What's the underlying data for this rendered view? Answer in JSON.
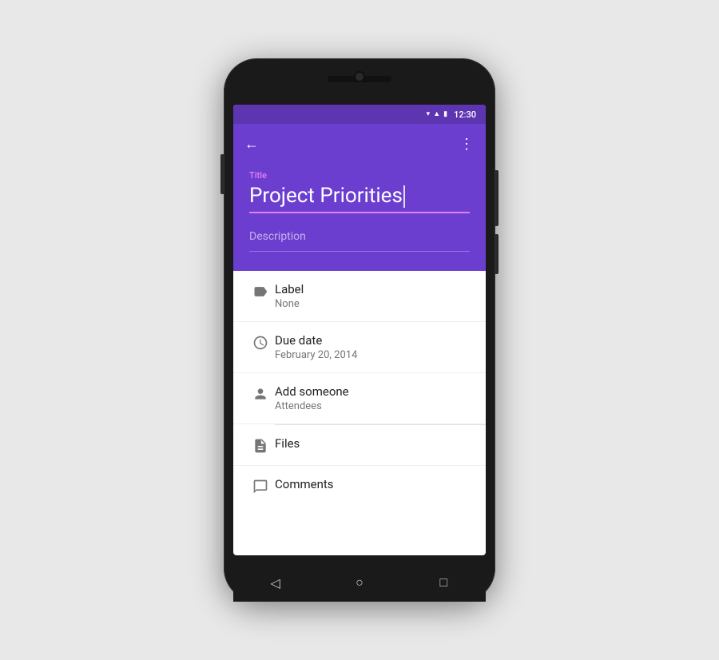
{
  "status_bar": {
    "time": "12:30"
  },
  "app_bar": {
    "back_label": "←",
    "more_label": "⋮"
  },
  "header": {
    "title_label": "Title",
    "title_text": "Project Priorities",
    "description_placeholder": "Description"
  },
  "list_items": [
    {
      "id": "label",
      "icon": "label-icon",
      "title": "Label",
      "subtitle": "None"
    },
    {
      "id": "due-date",
      "icon": "clock-icon",
      "title": "Due date",
      "subtitle": "February 20, 2014"
    },
    {
      "id": "add-someone",
      "icon": "person-icon",
      "title": "Add someone",
      "subtitle": "Attendees"
    },
    {
      "id": "files",
      "icon": "file-icon",
      "title": "Files",
      "subtitle": ""
    },
    {
      "id": "comments",
      "icon": "comment-icon",
      "title": "Comments",
      "subtitle": ""
    }
  ],
  "nav": {
    "back": "◁",
    "home": "○",
    "recent": "□"
  }
}
